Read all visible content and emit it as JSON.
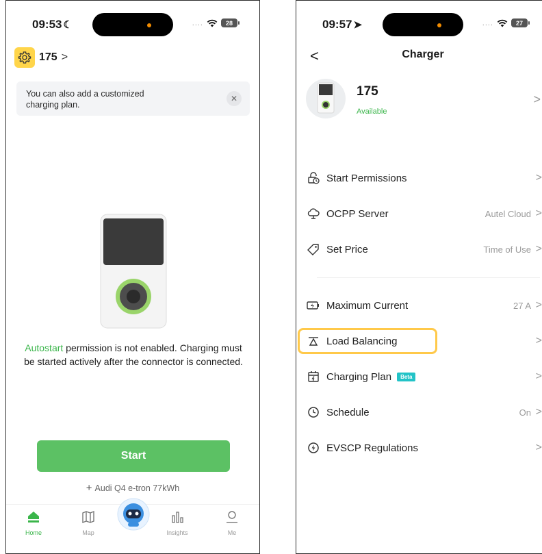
{
  "left_screen": {
    "status": {
      "time": "09:53",
      "time_glyph": "☾",
      "battery": "28"
    },
    "device": {
      "name": "175",
      "chevron": ">"
    },
    "tip": {
      "text": "You can also add a customized charging plan."
    },
    "autostart": {
      "link_text": "Autostart",
      "message": " permission is not enabled. Charging must be started actively after the connector is connected."
    },
    "start_button": "Start",
    "vehicle": {
      "plus": "+",
      "name": "Audi Q4 e-tron 77kWh"
    },
    "tabs": [
      {
        "label": "Home",
        "icon": "home-icon",
        "active": true
      },
      {
        "label": "Map",
        "icon": "map-icon",
        "active": false
      },
      {
        "label": "Insights",
        "icon": "insights-icon",
        "active": false
      },
      {
        "label": "Me",
        "icon": "profile-icon",
        "active": false
      }
    ]
  },
  "right_screen": {
    "status": {
      "time": "09:57",
      "time_glyph": "➤",
      "battery": "27"
    },
    "back": "<",
    "title": "Charger",
    "charger": {
      "name": "175",
      "status": "Available"
    },
    "rows": [
      {
        "label": "Start Permissions",
        "value": "",
        "icon": "permissions-icon"
      },
      {
        "label": "OCPP Server",
        "value": "Autel Cloud",
        "icon": "cloud-icon"
      },
      {
        "label": "Set Price",
        "value": "Time of Use",
        "icon": "price-tag-icon"
      },
      {
        "label": "Maximum Current",
        "value": "27 A",
        "icon": "current-icon"
      },
      {
        "label": "Load Balancing",
        "value": "",
        "icon": "balance-icon"
      },
      {
        "label": "Charging Plan",
        "value": "",
        "badge": "Beta",
        "icon": "calendar-icon"
      },
      {
        "label": "Schedule",
        "value": "On",
        "icon": "clock-icon"
      },
      {
        "label": "EVSCP Regulations",
        "value": "",
        "icon": "regulation-icon"
      }
    ],
    "chevron": ">"
  },
  "colors": {
    "accent_green": "#3ab54a",
    "button_green": "#5cc164",
    "highlight_yellow": "#ffc94a",
    "beta_badge": "#23c3c7"
  }
}
